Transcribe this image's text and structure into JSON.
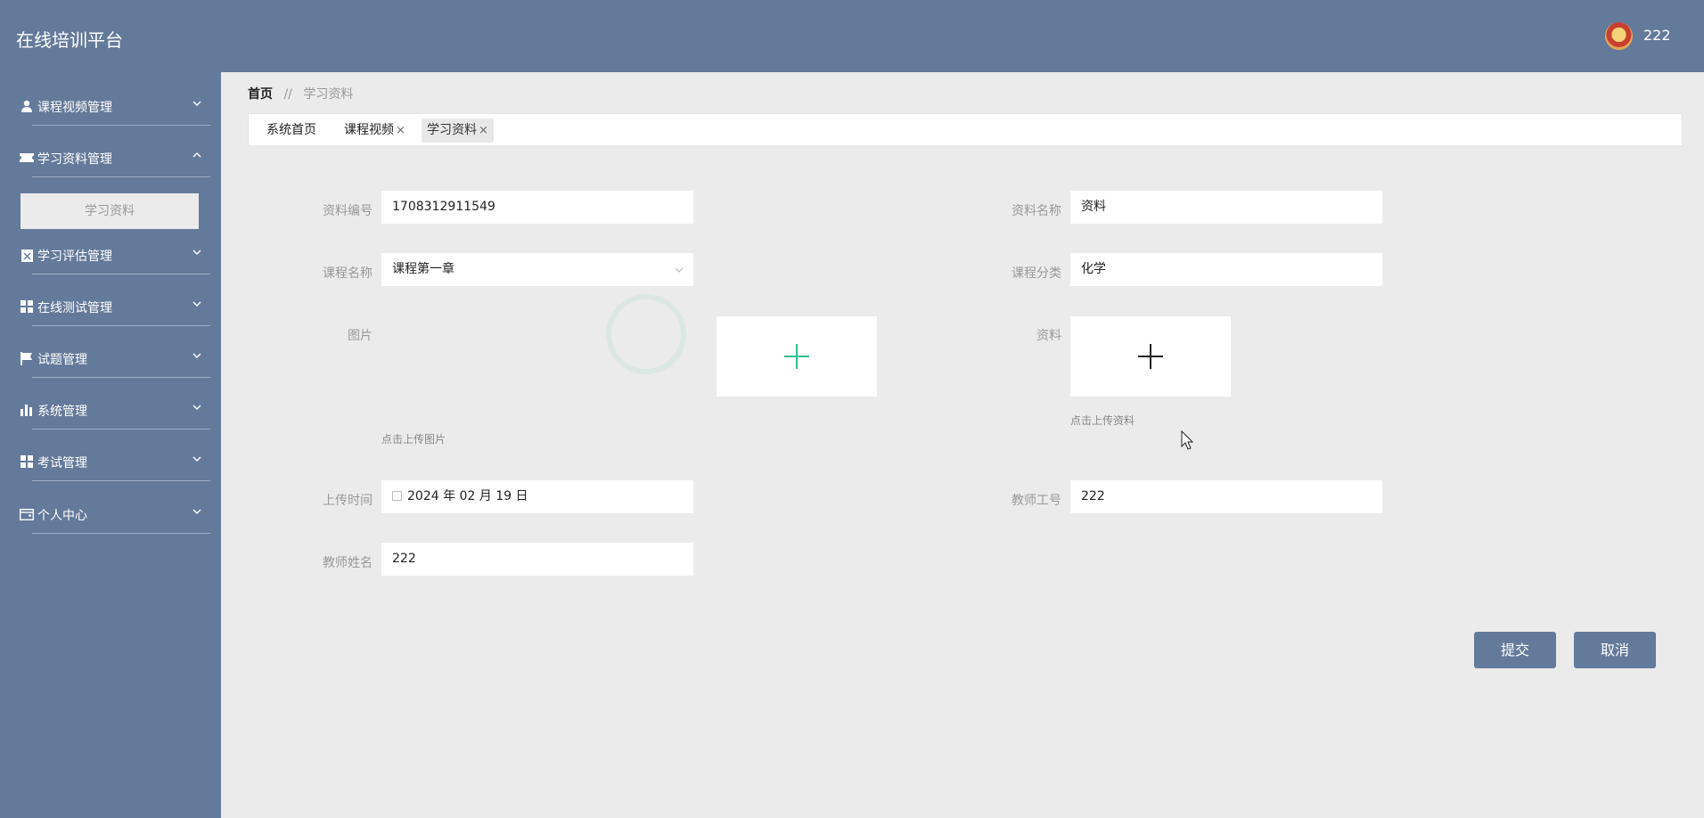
{
  "header": {
    "app_title": "在线培训平台",
    "username": "222",
    "avatar_icon": "avatar-icon"
  },
  "sidebar": {
    "items": [
      {
        "label": "课程视频管理",
        "icon": "user-icon",
        "expanded": false
      },
      {
        "label": "学习资料管理",
        "icon": "ticket-icon",
        "expanded": true
      },
      {
        "label": "学习评估管理",
        "icon": "clipboard-icon",
        "expanded": false
      },
      {
        "label": "在线测试管理",
        "icon": "grid-icon",
        "expanded": false
      },
      {
        "label": "试题管理",
        "icon": "flag-icon",
        "expanded": false
      },
      {
        "label": "系统管理",
        "icon": "bar-chart-icon",
        "expanded": false
      },
      {
        "label": "考试管理",
        "icon": "grid-icon",
        "expanded": false
      },
      {
        "label": "个人中心",
        "icon": "wallet-icon",
        "expanded": false
      }
    ],
    "submenu": {
      "label": "学习资料"
    }
  },
  "breadcrumb": {
    "home": "首页",
    "separator": "//",
    "current": "学习资料"
  },
  "tabs": [
    {
      "label": "系统首页",
      "closable": false
    },
    {
      "label": "课程视频",
      "closable": true
    },
    {
      "label": "学习资料",
      "closable": true,
      "active": true
    }
  ],
  "tab_close_glyph": "×",
  "form": {
    "material_no": {
      "label": "资料编号",
      "value": "1708312911549"
    },
    "material_name": {
      "label": "资料名称",
      "value": "资料"
    },
    "course_name": {
      "label": "课程名称",
      "value": "课程第一章"
    },
    "course_category": {
      "label": "课程分类",
      "value": "化学"
    },
    "image": {
      "label": "图片",
      "hint": "点击上传图片"
    },
    "file": {
      "label": "资料",
      "hint": "点击上传资料"
    },
    "upload_time": {
      "label": "上传时间",
      "value": "2024 年 02 月 19 日"
    },
    "teacher_no": {
      "label": "教师工号",
      "value": "222"
    },
    "teacher_name": {
      "label": "教师姓名",
      "value": "222"
    }
  },
  "buttons": {
    "submit": "提交",
    "cancel": "取消"
  },
  "colors": {
    "primary": "#647a9a",
    "background": "#ebebeb",
    "upload_plus_image": "#2fbf8f",
    "upload_plus_file": "#222222"
  }
}
